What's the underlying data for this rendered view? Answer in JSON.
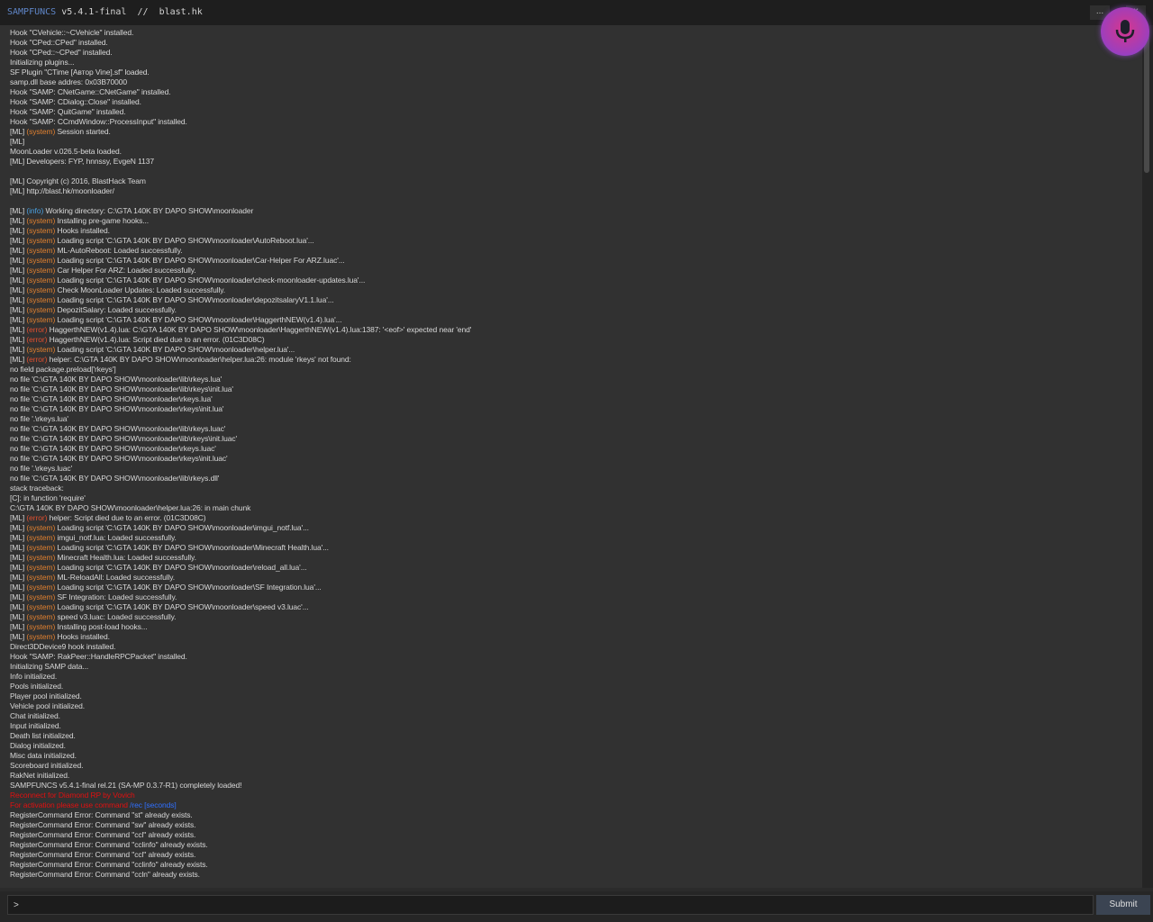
{
  "title": {
    "brand": "SAMPFUNCS",
    "rest": " v5.4.1-final  //  blast.hk"
  },
  "window_buttons": {
    "minimize": "...",
    "close": "×"
  },
  "mic_button": {
    "icon": "microphone-icon"
  },
  "console_lines": [
    [
      {
        "t": "Hook \"CVehicle::~CVehicle\" installed."
      }
    ],
    [
      {
        "t": "Hook \"CPed::CPed\" installed."
      }
    ],
    [
      {
        "t": "Hook \"CPed::~CPed\" installed."
      }
    ],
    [
      {
        "t": "Initializing plugins..."
      }
    ],
    [
      {
        "t": "SF Plugin \"CTime [Автор Vine].sf\" loaded."
      }
    ],
    [
      {
        "t": "samp.dll base addres: 0x03B70000"
      }
    ],
    [
      {
        "t": "Hook \"SAMP: CNetGame::CNetGame\" installed."
      }
    ],
    [
      {
        "t": "Hook \"SAMP: CDialog::Close\" installed."
      }
    ],
    [
      {
        "t": "Hook \"SAMP: QuitGame\" installed."
      }
    ],
    [
      {
        "t": "Hook \"SAMP: CCmdWindow::ProcessInput\" installed."
      }
    ],
    [
      {
        "t": "[ML] "
      },
      {
        "t": "(system)",
        "c": "sys"
      },
      {
        "t": " Session started."
      }
    ],
    [
      {
        "t": "[ML]"
      }
    ],
    [
      {
        "t": "MoonLoader v.026.5-beta loaded."
      }
    ],
    [
      {
        "t": "[ML] Developers: FYP, hnnssy, EvgeN 1137"
      }
    ],
    [
      {
        "t": ""
      }
    ],
    [
      {
        "t": "[ML] Copyright (c) 2016, BlastHack Team"
      }
    ],
    [
      {
        "t": "[ML] http://blast.hk/moonloader/"
      }
    ],
    [
      {
        "t": ""
      }
    ],
    [
      {
        "t": "[ML] "
      },
      {
        "t": "(info)",
        "c": "info"
      },
      {
        "t": " Working directory: C:\\GTA 140K BY DAPO SHOW\\moonloader"
      }
    ],
    [
      {
        "t": "[ML] "
      },
      {
        "t": "(system)",
        "c": "sys"
      },
      {
        "t": " Installing pre-game hooks..."
      }
    ],
    [
      {
        "t": "[ML] "
      },
      {
        "t": "(system)",
        "c": "sys"
      },
      {
        "t": " Hooks installed."
      }
    ],
    [
      {
        "t": "[ML] "
      },
      {
        "t": "(system)",
        "c": "sys"
      },
      {
        "t": " Loading script 'C:\\GTA 140K BY DAPO SHOW\\moonloader\\AutoReboot.lua'..."
      }
    ],
    [
      {
        "t": "[ML] "
      },
      {
        "t": "(system)",
        "c": "sys"
      },
      {
        "t": " ML-AutoReboot: Loaded successfully."
      }
    ],
    [
      {
        "t": "[ML] "
      },
      {
        "t": "(system)",
        "c": "sys"
      },
      {
        "t": " Loading script 'C:\\GTA 140K BY DAPO SHOW\\moonloader\\Car-Helper For ARZ.luac'..."
      }
    ],
    [
      {
        "t": "[ML] "
      },
      {
        "t": "(system)",
        "c": "sys"
      },
      {
        "t": " Car Helper For ARZ: Loaded successfully."
      }
    ],
    [
      {
        "t": "[ML] "
      },
      {
        "t": "(system)",
        "c": "sys"
      },
      {
        "t": " Loading script 'C:\\GTA 140K BY DAPO SHOW\\moonloader\\check-moonloader-updates.lua'..."
      }
    ],
    [
      {
        "t": "[ML] "
      },
      {
        "t": "(system)",
        "c": "sys"
      },
      {
        "t": " Check MoonLoader Updates: Loaded successfully."
      }
    ],
    [
      {
        "t": "[ML] "
      },
      {
        "t": "(system)",
        "c": "sys"
      },
      {
        "t": " Loading script 'C:\\GTA 140K BY DAPO SHOW\\moonloader\\depozitsalaryV1.1.lua'..."
      }
    ],
    [
      {
        "t": "[ML] "
      },
      {
        "t": "(system)",
        "c": "sys"
      },
      {
        "t": " DepozitSalary: Loaded successfully."
      }
    ],
    [
      {
        "t": "[ML] "
      },
      {
        "t": "(system)",
        "c": "sys"
      },
      {
        "t": " Loading script 'C:\\GTA 140K BY DAPO SHOW\\moonloader\\HaggerthNEW(v1.4).lua'..."
      }
    ],
    [
      {
        "t": "[ML] "
      },
      {
        "t": "(error)",
        "c": "err"
      },
      {
        "t": " HaggerthNEW(v1.4).lua: C:\\GTA 140K BY DAPO SHOW\\moonloader\\HaggerthNEW(v1.4).lua:1387: '<eof>' expected near 'end'"
      }
    ],
    [
      {
        "t": "[ML] "
      },
      {
        "t": "(error)",
        "c": "err"
      },
      {
        "t": " HaggerthNEW(v1.4).lua: Script died due to an error. (01C3D08C)"
      }
    ],
    [
      {
        "t": "[ML] "
      },
      {
        "t": "(system)",
        "c": "sys"
      },
      {
        "t": " Loading script 'C:\\GTA 140K BY DAPO SHOW\\moonloader\\helper.lua'..."
      }
    ],
    [
      {
        "t": "[ML] "
      },
      {
        "t": "(error)",
        "c": "err"
      },
      {
        "t": " helper: C:\\GTA 140K BY DAPO SHOW\\moonloader\\helper.lua:26: module 'rkeys' not found:"
      }
    ],
    [
      {
        "t": "no field package.preload['rkeys']"
      }
    ],
    [
      {
        "t": "no file 'C:\\GTA 140K BY DAPO SHOW\\moonloader\\lib\\rkeys.lua'"
      }
    ],
    [
      {
        "t": "no file 'C:\\GTA 140K BY DAPO SHOW\\moonloader\\lib\\rkeys\\init.lua'"
      }
    ],
    [
      {
        "t": "no file 'C:\\GTA 140K BY DAPO SHOW\\moonloader\\rkeys.lua'"
      }
    ],
    [
      {
        "t": "no file 'C:\\GTA 140K BY DAPO SHOW\\moonloader\\rkeys\\init.lua'"
      }
    ],
    [
      {
        "t": "no file '.\\rkeys.lua'"
      }
    ],
    [
      {
        "t": "no file 'C:\\GTA 140K BY DAPO SHOW\\moonloader\\lib\\rkeys.luac'"
      }
    ],
    [
      {
        "t": "no file 'C:\\GTA 140K BY DAPO SHOW\\moonloader\\lib\\rkeys\\init.luac'"
      }
    ],
    [
      {
        "t": "no file 'C:\\GTA 140K BY DAPO SHOW\\moonloader\\rkeys.luac'"
      }
    ],
    [
      {
        "t": "no file 'C:\\GTA 140K BY DAPO SHOW\\moonloader\\rkeys\\init.luac'"
      }
    ],
    [
      {
        "t": "no file '.\\rkeys.luac'"
      }
    ],
    [
      {
        "t": "no file 'C:\\GTA 140K BY DAPO SHOW\\moonloader\\lib\\rkeys.dll'"
      }
    ],
    [
      {
        "t": "stack traceback:"
      }
    ],
    [
      {
        "t": "[C]: in function 'require'"
      }
    ],
    [
      {
        "t": "C:\\GTA 140K BY DAPO SHOW\\moonloader\\helper.lua:26: in main chunk"
      }
    ],
    [
      {
        "t": "[ML] "
      },
      {
        "t": "(error)",
        "c": "err"
      },
      {
        "t": " helper: Script died due to an error. (01C3D08C)"
      }
    ],
    [
      {
        "t": "[ML] "
      },
      {
        "t": "(system)",
        "c": "sys"
      },
      {
        "t": " Loading script 'C:\\GTA 140K BY DAPO SHOW\\moonloader\\imgui_notf.lua'..."
      }
    ],
    [
      {
        "t": "[ML] "
      },
      {
        "t": "(system)",
        "c": "sys"
      },
      {
        "t": " imgui_notf.lua: Loaded successfully."
      }
    ],
    [
      {
        "t": "[ML] "
      },
      {
        "t": "(system)",
        "c": "sys"
      },
      {
        "t": " Loading script 'C:\\GTA 140K BY DAPO SHOW\\moonloader\\Minecraft Health.lua'..."
      }
    ],
    [
      {
        "t": "[ML] "
      },
      {
        "t": "(system)",
        "c": "sys"
      },
      {
        "t": " Minecraft Health.lua: Loaded successfully."
      }
    ],
    [
      {
        "t": "[ML] "
      },
      {
        "t": "(system)",
        "c": "sys"
      },
      {
        "t": " Loading script 'C:\\GTA 140K BY DAPO SHOW\\moonloader\\reload_all.lua'..."
      }
    ],
    [
      {
        "t": "[ML] "
      },
      {
        "t": "(system)",
        "c": "sys"
      },
      {
        "t": " ML-ReloadAll: Loaded successfully."
      }
    ],
    [
      {
        "t": "[ML] "
      },
      {
        "t": "(system)",
        "c": "sys"
      },
      {
        "t": " Loading script 'C:\\GTA 140K BY DAPO SHOW\\moonloader\\SF Integration.lua'..."
      }
    ],
    [
      {
        "t": "[ML] "
      },
      {
        "t": "(system)",
        "c": "sys"
      },
      {
        "t": " SF Integration: Loaded successfully."
      }
    ],
    [
      {
        "t": "[ML] "
      },
      {
        "t": "(system)",
        "c": "sys"
      },
      {
        "t": " Loading script 'C:\\GTA 140K BY DAPO SHOW\\moonloader\\speed v3.luac'..."
      }
    ],
    [
      {
        "t": "[ML] "
      },
      {
        "t": "(system)",
        "c": "sys"
      },
      {
        "t": " speed v3.luac: Loaded successfully."
      }
    ],
    [
      {
        "t": "[ML] "
      },
      {
        "t": "(system)",
        "c": "sys"
      },
      {
        "t": " Installing post-load hooks..."
      }
    ],
    [
      {
        "t": "[ML] "
      },
      {
        "t": "(system)",
        "c": "sys"
      },
      {
        "t": " Hooks installed."
      }
    ],
    [
      {
        "t": "Direct3DDevice9 hook installed."
      }
    ],
    [
      {
        "t": "Hook \"SAMP: RakPeer::HandleRPCPacket\" installed."
      }
    ],
    [
      {
        "t": "Initializing SAMP data..."
      }
    ],
    [
      {
        "t": "Info initialized."
      }
    ],
    [
      {
        "t": "Pools initialized."
      }
    ],
    [
      {
        "t": "Player pool initialized."
      }
    ],
    [
      {
        "t": "Vehicle pool initialized."
      }
    ],
    [
      {
        "t": "Chat initialized."
      }
    ],
    [
      {
        "t": "Input initialized."
      }
    ],
    [
      {
        "t": "Death list initialized."
      }
    ],
    [
      {
        "t": "Dialog initialized."
      }
    ],
    [
      {
        "t": "Misc data initialized."
      }
    ],
    [
      {
        "t": "Scoreboard initialized."
      }
    ],
    [
      {
        "t": "RakNet initialized."
      }
    ],
    [
      {
        "t": "SAMPFUNCS v5.4.1-final rel.21 (SA-MP 0.3.7-R1) completely loaded!"
      }
    ],
    [
      {
        "t": "Reconnect for Diamond RP by Vovich",
        "c": "red"
      }
    ],
    [
      {
        "t": "For activation please use command ",
        "c": "red"
      },
      {
        "t": "/rec [seconds]",
        "c": "blue"
      }
    ],
    [
      {
        "t": "RegisterCommand Error: Command \"st\" already exists."
      }
    ],
    [
      {
        "t": "RegisterCommand Error: Command \"sw\" already exists."
      }
    ],
    [
      {
        "t": "RegisterCommand Error: Command \"ccl\" already exists."
      }
    ],
    [
      {
        "t": "RegisterCommand Error: Command \"cclinfo\" already exists."
      }
    ],
    [
      {
        "t": "RegisterCommand Error: Command \"ccl\" already exists."
      }
    ],
    [
      {
        "t": "RegisterCommand Error: Command \"cclinfo\" already exists."
      }
    ],
    [
      {
        "t": "RegisterCommand Error: Command \"ccln\" already exists."
      }
    ]
  ],
  "command_input": {
    "prompt": ">",
    "value": ""
  },
  "submit_label": "Submit",
  "colors": {
    "system": "#e08030",
    "error": "#e05030",
    "info": "#4aa0e0",
    "red_text": "#e01010",
    "blue_text": "#3070ff",
    "accent": "#5f86c8"
  }
}
